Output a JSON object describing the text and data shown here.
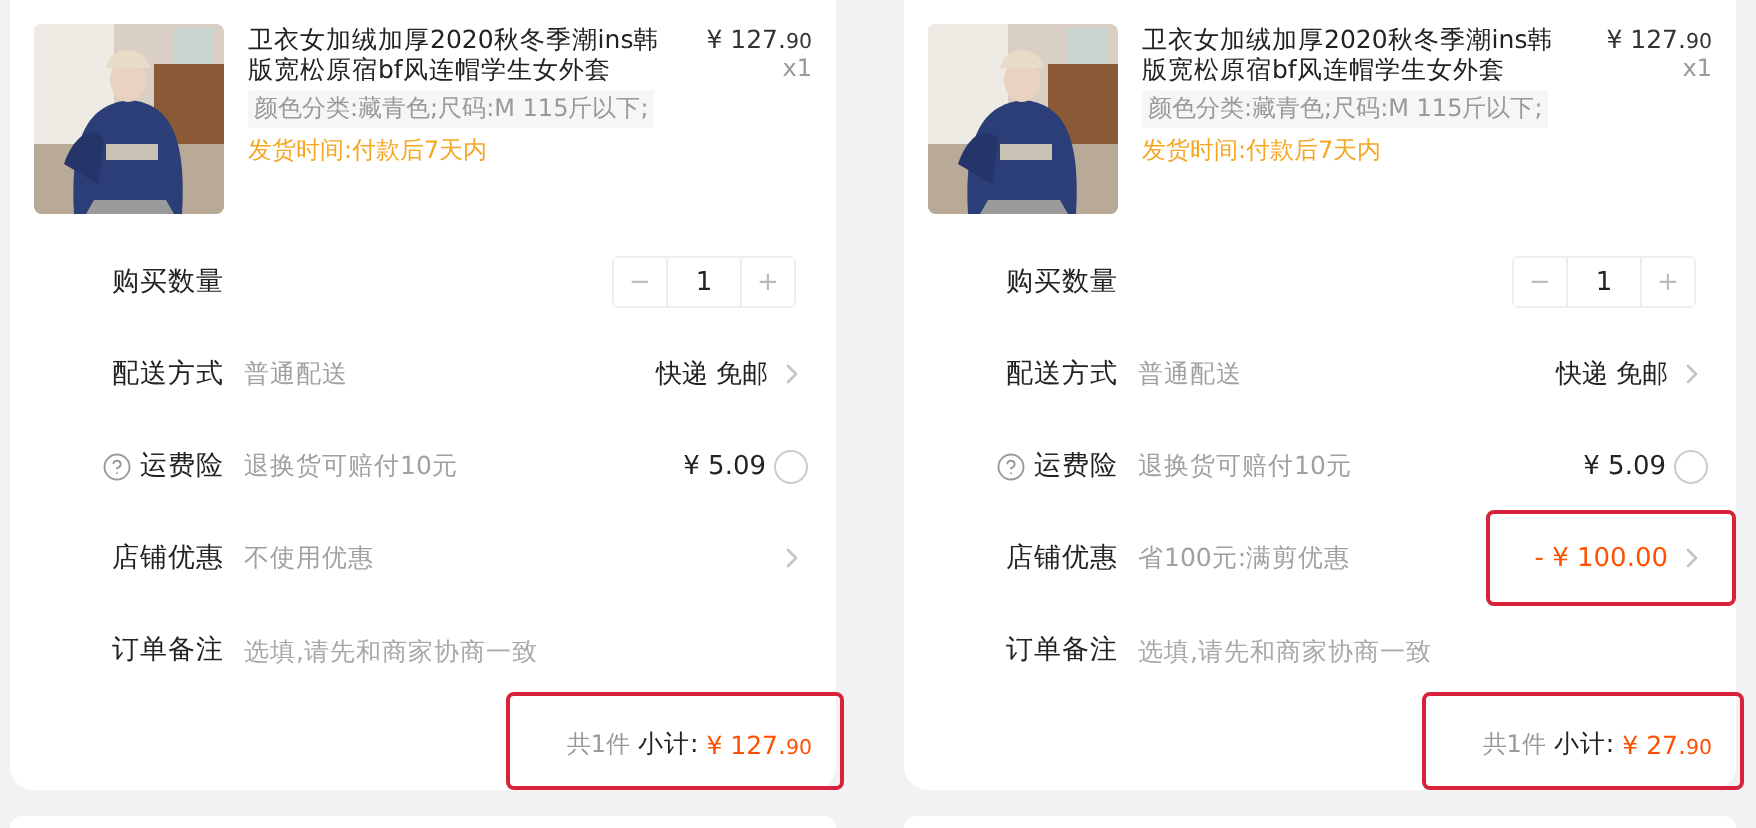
{
  "panels": [
    {
      "product": {
        "kind": "picture",
        "title": "卫衣女加绒加厚2020秋冬季潮ins韩版宽松原宿bf风连帽学生女外套",
        "price_main": "¥ 127.",
        "price_decimal": "90",
        "quantity": "x1",
        "sku": "颜色分类:藏青色;尺码:M 115斤以下;",
        "shipping": "发货时间:付款后7天内"
      },
      "rows": [
        {
          "kind": "stepper",
          "label": "购买数量",
          "minus": "−",
          "value": "1",
          "plus": "+"
        },
        {
          "kind": "link",
          "label": "配送方式",
          "hint": "普通配送",
          "value": "快递 免邮"
        },
        {
          "kind": "toggle",
          "label": "运费险",
          "hint": "退换货可赔付10元",
          "value": "¥ 5.09",
          "checked": false
        },
        {
          "kind": "link",
          "label": "店铺优惠",
          "hint": "不使用优惠"
        },
        {
          "kind": "note",
          "label": "订单备注",
          "placeholder": "选填,请先和商家协商一致"
        }
      ],
      "subtotal": {
        "count": "共1件",
        "label": "小计:",
        "price_main": "¥ 127.",
        "price_decimal": "90",
        "highlighted": true
      }
    },
    {
      "product": {
        "kind": "picture",
        "title": "卫衣女加绒加厚2020秋冬季潮ins韩版宽松原宿bf风连帽学生女外套",
        "price_main": "¥ 127.",
        "price_decimal": "90",
        "quantity": "x1",
        "sku": "颜色分类:藏青色;尺码:M 115斤以下;",
        "shipping": "发货时间:付款后7天内"
      },
      "rows": [
        {
          "kind": "stepper",
          "label": "购买数量",
          "minus": "−",
          "value": "1",
          "plus": "+"
        },
        {
          "kind": "link",
          "label": "配送方式",
          "hint": "普通配送",
          "value": "快递 免邮"
        },
        {
          "kind": "toggle",
          "label": "运费险",
          "hint": "退换货可赔付10元",
          "value": "¥ 5.09",
          "checked": false
        },
        {
          "kind": "link",
          "label": "店铺优惠",
          "hint": "省100元:满剪优惠",
          "value": "- ¥ 100.00",
          "accent": true,
          "highlighted": true
        },
        {
          "kind": "note",
          "label": "订单备注",
          "placeholder": "选填,请先和商家协商一致"
        }
      ],
      "subtotal": {
        "count": "共1件",
        "label": "小计:",
        "price_main": "¥ 27.",
        "price_decimal": "90",
        "highlighted": true
      }
    }
  ]
}
